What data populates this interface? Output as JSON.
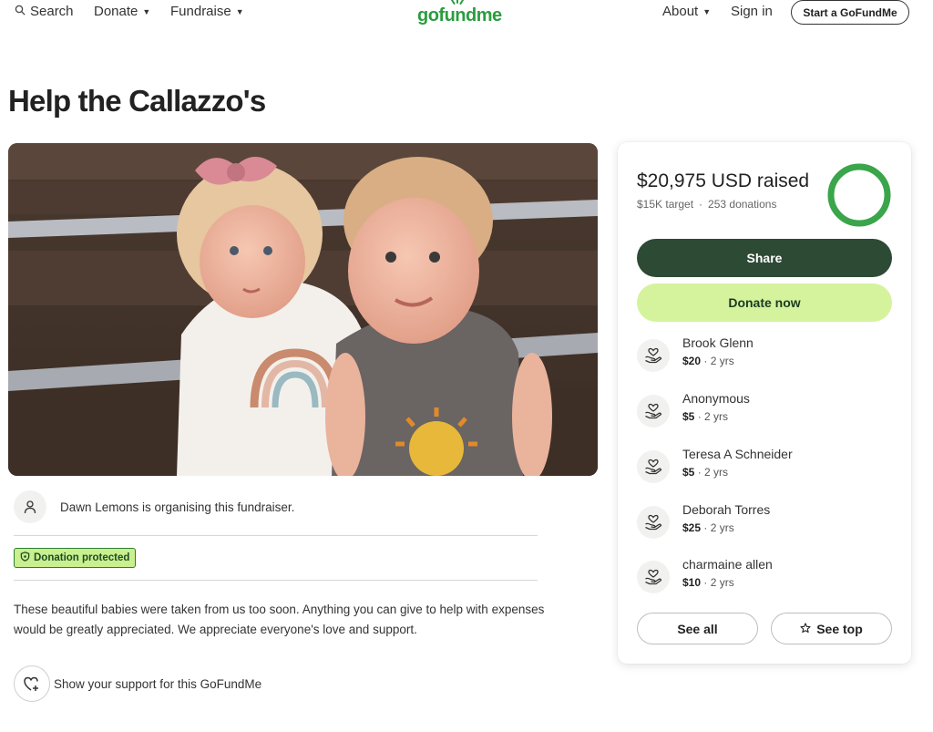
{
  "header": {
    "search_label": "Search",
    "donate_label": "Donate",
    "fundraise_label": "Fundraise",
    "logo_text": "gofundme",
    "about_label": "About",
    "signin_label": "Sign in",
    "start_label": "Start a GoFundMe"
  },
  "campaign": {
    "title": "Help the Callazzo's",
    "organiser_text": "Dawn Lemons is organising this fundraiser.",
    "protected_label": "Donation protected",
    "story": "These beautiful babies were taken from us too soon. Anything you can give to help with expenses would be greatly appreciated. We appreciate everyone's love and support.",
    "support_text": "Show your support for this GoFundMe"
  },
  "card": {
    "raised": "$20,975 USD raised",
    "target": "$15K target",
    "donation_count": "253 donations",
    "progress_fraction": 1.0,
    "share_label": "Share",
    "donate_label": "Donate now",
    "see_all_label": "See all",
    "see_top_label": "See top",
    "donations": [
      {
        "name": "Brook Glenn",
        "amount": "$20",
        "time": "2 yrs"
      },
      {
        "name": "Anonymous",
        "amount": "$5",
        "time": "2 yrs"
      },
      {
        "name": "Teresa A Schneider",
        "amount": "$5",
        "time": "2 yrs"
      },
      {
        "name": "Deborah Torres",
        "amount": "$25",
        "time": "2 yrs"
      },
      {
        "name": "charmaine allen",
        "amount": "$10",
        "time": "2 yrs"
      }
    ]
  },
  "colors": {
    "brand_green": "#2a9d3f",
    "share_bg": "#2d4a35",
    "donate_bg": "#d5f39d",
    "protected_bg": "#c9ef8f",
    "ring_green": "#3aa54a"
  },
  "icons": {
    "search": "search-icon",
    "user": "user-icon",
    "shield": "shield-icon",
    "heart_hand": "heart-hand-icon",
    "heart_plus": "heart-plus-icon",
    "star": "star-icon",
    "caret": "caret-down-icon"
  }
}
